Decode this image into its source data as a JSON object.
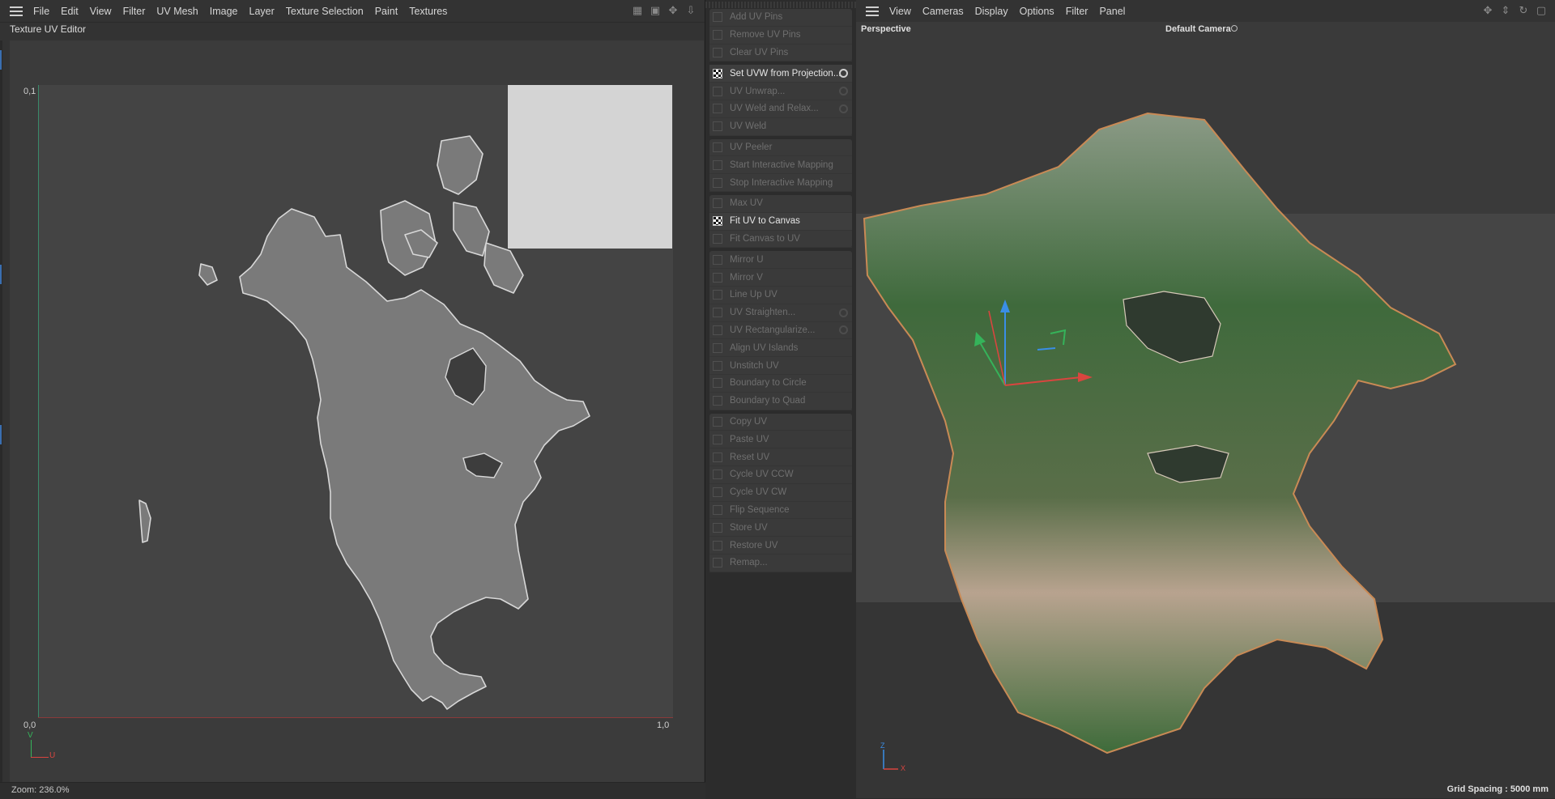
{
  "uv_editor": {
    "menu": [
      "File",
      "Edit",
      "View",
      "Filter",
      "UV Mesh",
      "Image",
      "Layer",
      "Texture Selection",
      "Paint",
      "Textures"
    ],
    "title": "Texture UV Editor",
    "axis": {
      "top_left": "0,1",
      "bottom_left": "0,0",
      "bottom_right": "1,0",
      "v_label": "V",
      "u_label": "U"
    },
    "status": "Zoom: 236.0%"
  },
  "commands": {
    "groups": [
      [
        {
          "label": "Add UV Pins",
          "enabled": false,
          "gear": false
        },
        {
          "label": "Remove UV Pins",
          "enabled": false,
          "gear": false
        },
        {
          "label": "Clear UV Pins",
          "enabled": false,
          "gear": false
        }
      ],
      [
        {
          "label": "Set UVW from Projection...",
          "enabled": true,
          "gear": true
        },
        {
          "label": "UV Unwrap...",
          "enabled": false,
          "gear": true
        },
        {
          "label": "UV Weld and Relax...",
          "enabled": false,
          "gear": true
        },
        {
          "label": "UV Weld",
          "enabled": false,
          "gear": false
        }
      ],
      [
        {
          "label": "UV Peeler",
          "enabled": false,
          "gear": false
        },
        {
          "label": "Start Interactive Mapping",
          "enabled": false,
          "gear": false
        },
        {
          "label": "Stop Interactive Mapping",
          "enabled": false,
          "gear": false
        }
      ],
      [
        {
          "label": "Max UV",
          "enabled": false,
          "gear": false
        },
        {
          "label": "Fit UV to Canvas",
          "enabled": true,
          "gear": false
        },
        {
          "label": "Fit Canvas to UV",
          "enabled": false,
          "gear": false
        }
      ],
      [
        {
          "label": "Mirror U",
          "enabled": false,
          "gear": false
        },
        {
          "label": "Mirror V",
          "enabled": false,
          "gear": false
        },
        {
          "label": "Line Up UV",
          "enabled": false,
          "gear": false
        },
        {
          "label": "UV Straighten...",
          "enabled": false,
          "gear": true
        },
        {
          "label": "UV Rectangularize...",
          "enabled": false,
          "gear": true
        },
        {
          "label": "Align UV Islands",
          "enabled": false,
          "gear": false
        },
        {
          "label": "Unstitch UV",
          "enabled": false,
          "gear": false
        },
        {
          "label": "Boundary to Circle",
          "enabled": false,
          "gear": false
        },
        {
          "label": "Boundary to Quad",
          "enabled": false,
          "gear": false
        }
      ],
      [
        {
          "label": "Copy UV",
          "enabled": false,
          "gear": false
        },
        {
          "label": "Paste UV",
          "enabled": false,
          "gear": false
        },
        {
          "label": "Reset UV",
          "enabled": false,
          "gear": false
        },
        {
          "label": "Cycle UV CCW",
          "enabled": false,
          "gear": false
        },
        {
          "label": "Cycle UV CW",
          "enabled": false,
          "gear": false
        },
        {
          "label": "Flip Sequence",
          "enabled": false,
          "gear": false
        },
        {
          "label": "Store UV",
          "enabled": false,
          "gear": false
        },
        {
          "label": "Restore UV",
          "enabled": false,
          "gear": false
        },
        {
          "label": "Remap...",
          "enabled": false,
          "gear": false
        }
      ]
    ]
  },
  "viewport": {
    "menu": [
      "View",
      "Cameras",
      "Display",
      "Options",
      "Filter",
      "Panel"
    ],
    "projection": "Perspective",
    "camera": "Default Camera",
    "grid_spacing": "Grid Spacing : 5000 mm",
    "axes": {
      "z": "Z",
      "x": "X"
    }
  },
  "colors": {
    "x_axis": "#d9453f",
    "y_axis": "#35b35a",
    "z_axis": "#3a8ee6",
    "uv_island": "#7a7a7a",
    "land_green": "#3e6b3a"
  }
}
